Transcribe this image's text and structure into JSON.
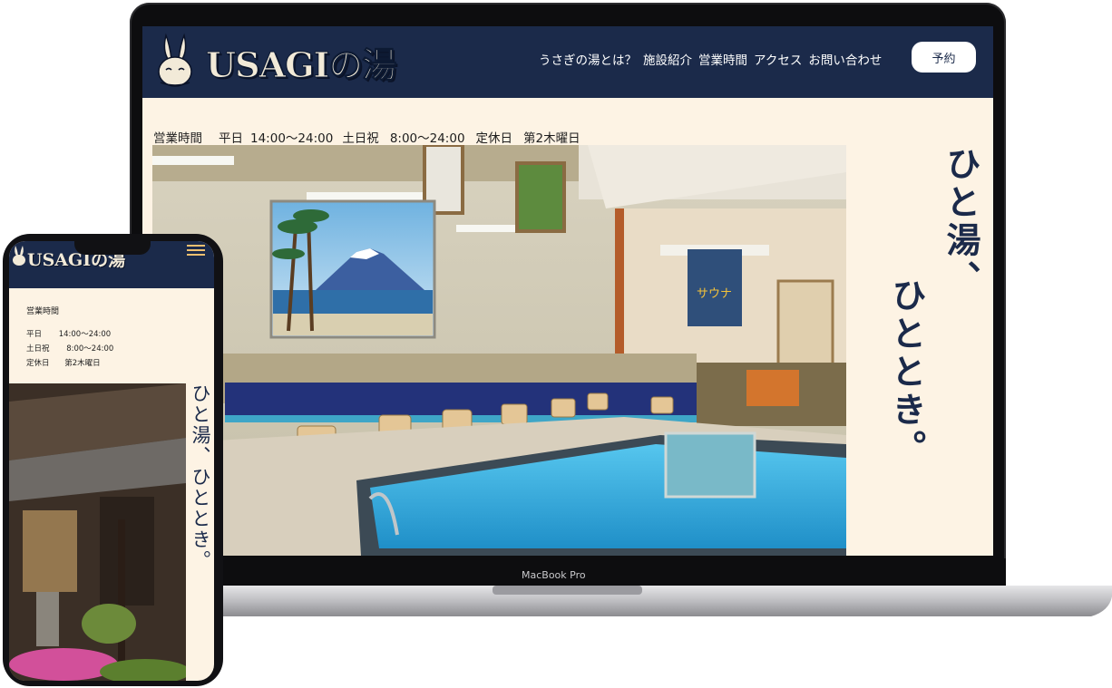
{
  "site": {
    "logo_text": "USAGIの湯",
    "nav": [
      "うさぎの湯とは？",
      "施設紹介",
      "営業時間",
      "アクセス",
      "お問い合わせ"
    ],
    "reserve_label": "予約",
    "hours": {
      "title": "営業時間",
      "weekday_label": "平日",
      "weekday_time": "14:00〜24:00",
      "holiday_label": "土日祝",
      "holiday_time": "8:00〜24:00",
      "closed_label": "定休日",
      "closed_value": "第2木曜日"
    },
    "tagline_col1": "ひと湯、",
    "tagline_col2": "ひととき。",
    "tagline_line1": "ひと",
    "tagline_line2": "湯、",
    "sauna_sign": "サウナ"
  },
  "device": {
    "brand_label": "MacBook Pro"
  },
  "phone": {
    "logo_text": "USAGIの湯",
    "tagline": "ひと湯、ひととき。"
  },
  "colors": {
    "navy": "#1b2a4a",
    "cream": "#fdf3e4",
    "pool": "#38b3e0"
  }
}
